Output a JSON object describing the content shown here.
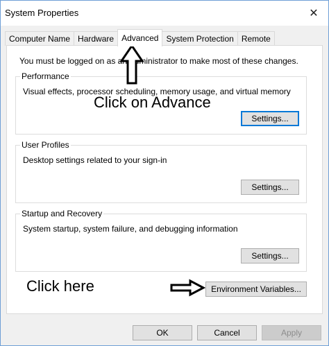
{
  "window": {
    "title": "System Properties",
    "close_label": "✕"
  },
  "tabs": [
    {
      "label": "Computer Name",
      "active": false
    },
    {
      "label": "Hardware",
      "active": false
    },
    {
      "label": "Advanced",
      "active": true
    },
    {
      "label": "System Protection",
      "active": false
    },
    {
      "label": "Remote",
      "active": false
    }
  ],
  "panel": {
    "admin_note": "You must be logged on as an Administrator to make most of these changes.",
    "performance": {
      "legend": "Performance",
      "description": "Visual effects, processor scheduling, memory usage, and virtual memory",
      "button": "Settings..."
    },
    "user_profiles": {
      "legend": "User Profiles",
      "description": "Desktop settings related to your sign-in",
      "button": "Settings..."
    },
    "startup_recovery": {
      "legend": "Startup and Recovery",
      "description": "System startup, system failure, and debugging information",
      "button": "Settings..."
    },
    "env_button": "Environment Variables..."
  },
  "annotations": {
    "advance_text": "Click on Advance",
    "here_text": "Click here"
  },
  "footer": {
    "ok": "OK",
    "cancel": "Cancel",
    "apply": "Apply"
  }
}
